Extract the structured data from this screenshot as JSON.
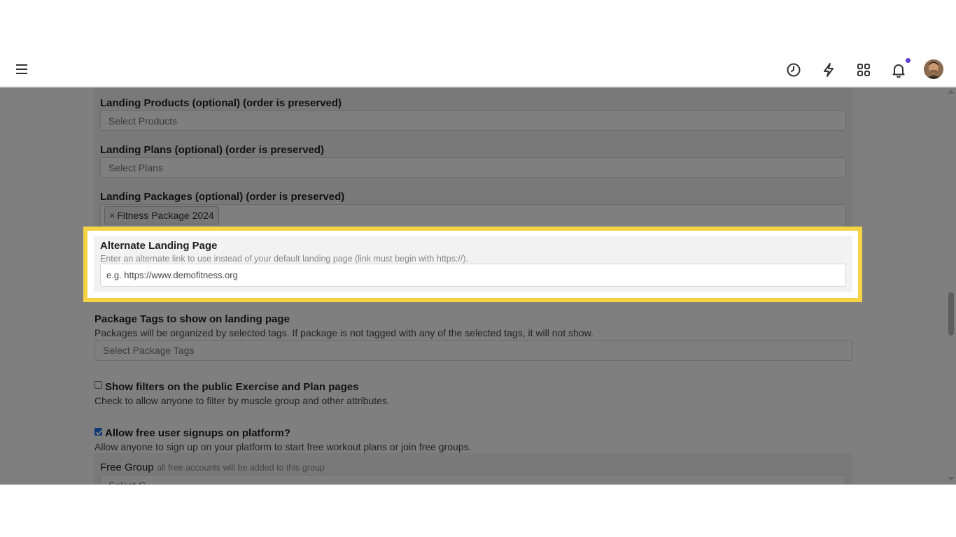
{
  "header": {
    "menu_icon": "hamburger-icon",
    "icons": [
      "clock-history-icon",
      "lightning-bolt-icon",
      "grid-apps-icon",
      "bell-icon"
    ],
    "notification_dot_color": "#5b3fd6",
    "avatar": "user-avatar"
  },
  "form": {
    "landing_products": {
      "label": "Landing Products (optional) (order is preserved)",
      "placeholder": "Select Products"
    },
    "landing_plans": {
      "label": "Landing Plans (optional) (order is preserved)",
      "placeholder": "Select Plans"
    },
    "landing_packages": {
      "label": "Landing Packages (optional) (order is preserved)",
      "tag_remove": "×",
      "tag": "Fitness Package 2024"
    },
    "alternate_landing": {
      "label": "Alternate Landing Page",
      "hint": "Enter an alternate link to use instead of your default landing page (link must begin with https://).",
      "placeholder": "e.g. https://www.demofitness.org"
    },
    "package_tags": {
      "label": "Package Tags to show on landing page",
      "hint": "Packages will be organized by selected tags. If package is not tagged with any of the selected tags, it will not show.",
      "placeholder": "Select Package Tags"
    },
    "show_filters": {
      "label": "Show filters on the public Exercise and Plan pages",
      "hint": "Check to allow anyone to filter by muscle group and other attributes.",
      "checked": false
    },
    "free_signups": {
      "label": "Allow free user signups on platform?",
      "hint": "Allow anyone to sign up on your platform to start free workout plans or join free groups.",
      "checked": true
    },
    "free_group": {
      "label": "Free Group",
      "hint": "all free accounts will be added to this group",
      "placeholder": "Select G"
    }
  },
  "highlight_color": "#f6d245"
}
